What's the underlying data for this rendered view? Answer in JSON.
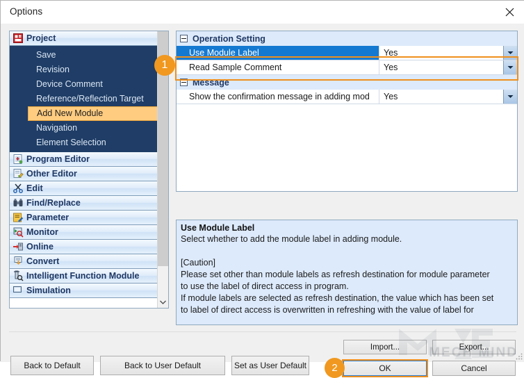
{
  "window": {
    "title": "Options",
    "close_icon": "close-icon"
  },
  "sidebar": {
    "project": {
      "label": "Project",
      "icon": "project-icon",
      "children": [
        {
          "label": "Save",
          "selected": false
        },
        {
          "label": "Revision",
          "selected": false
        },
        {
          "label": "Device Comment",
          "selected": false
        },
        {
          "label": "Reference/Reflection Target",
          "selected": false
        },
        {
          "label": "Add New Module",
          "selected": true
        },
        {
          "label": "Navigation",
          "selected": false
        },
        {
          "label": "Element Selection",
          "selected": false
        }
      ]
    },
    "categories": [
      {
        "label": "Program Editor",
        "icon": "program-editor-icon"
      },
      {
        "label": "Other Editor",
        "icon": "other-editor-icon"
      },
      {
        "label": "Edit",
        "icon": "scissors-icon"
      },
      {
        "label": "Find/Replace",
        "icon": "binoculars-icon"
      },
      {
        "label": "Parameter",
        "icon": "parameter-icon"
      },
      {
        "label": "Monitor",
        "icon": "monitor-icon"
      },
      {
        "label": "Online",
        "icon": "online-icon"
      },
      {
        "label": "Convert",
        "icon": "convert-icon"
      },
      {
        "label": "Intelligent Function Module",
        "icon": "intelligent-module-icon"
      },
      {
        "label": "Simulation",
        "icon": "simulation-icon"
      }
    ],
    "scrollbar": {
      "down_icon": "chevron-down-icon"
    }
  },
  "settings_grid": {
    "groups": [
      {
        "label": "Operation Setting",
        "toggle_icon": "collapse-minus-icon",
        "rows": [
          {
            "name": "Use Module Label",
            "value": "Yes",
            "selected": true,
            "dropdown_icon": "chevron-down-icon"
          },
          {
            "name": "Read Sample Comment",
            "value": "Yes",
            "selected": false,
            "dropdown_icon": "chevron-down-icon"
          }
        ]
      },
      {
        "label": "Message",
        "toggle_icon": "collapse-minus-icon",
        "rows": [
          {
            "name": "Show the confirmation message in adding mod",
            "value": "Yes",
            "selected": false,
            "dropdown_icon": "chevron-down-icon"
          }
        ]
      }
    ]
  },
  "description": {
    "title": "Use Module Label",
    "lines": [
      "Select whether to add the module label in adding module.",
      "",
      "[Caution]",
      "Please set other than module labels as refresh destination for module parameter",
      "to use the label of direct access in program.",
      "If module labels are selected as refresh destination, the value which has been set",
      "to label of direct access is overwritten in refreshing with the value of label for"
    ]
  },
  "footer": {
    "back_to_default": "Back to Default",
    "back_to_user_default": "Back to User Default",
    "set_as_user_default": "Set as User Default",
    "import": "Import...",
    "export": "Export...",
    "ok": "OK",
    "cancel": "Cancel"
  },
  "annotations": {
    "badge_1": "1",
    "badge_2": "2"
  },
  "watermark": {
    "text": "MECH MIND"
  },
  "colors": {
    "accent_orange": "#ef8f1c",
    "selection_blue": "#1479d1",
    "sidebar_navy": "#1f3d66",
    "highlight_amber": "#ffcc80",
    "panel_blue": "#ddeafb"
  }
}
